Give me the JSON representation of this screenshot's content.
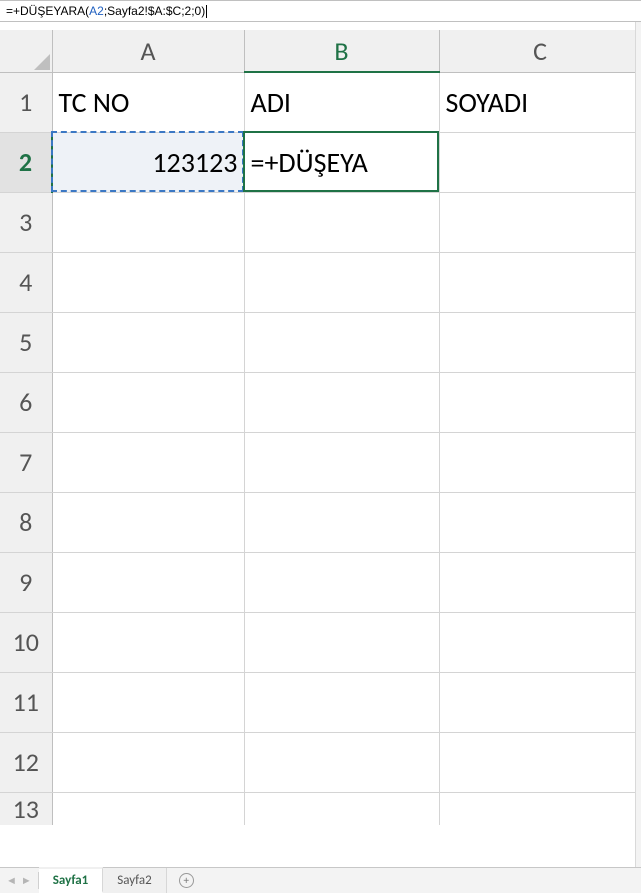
{
  "formula_bar": {
    "prefix": "=+DÜŞEYARA(",
    "ref_arg": "A2",
    "rest": ";Sayfa2!$A:$C;2;0)"
  },
  "columns": [
    "A",
    "B",
    "C"
  ],
  "rows": [
    "1",
    "2",
    "3",
    "4",
    "5",
    "6",
    "7",
    "8",
    "9",
    "10",
    "11",
    "12",
    "13"
  ],
  "active_col_index": 1,
  "active_row_index": 1,
  "cells": {
    "A1": "TC NO",
    "B1": "ADI",
    "C1": "SOYADI",
    "A2": "123123",
    "B2": "=+DÜŞEYA"
  },
  "sheets": {
    "active": "Sayfa1",
    "tabs": [
      "Sayfa1",
      "Sayfa2"
    ]
  }
}
